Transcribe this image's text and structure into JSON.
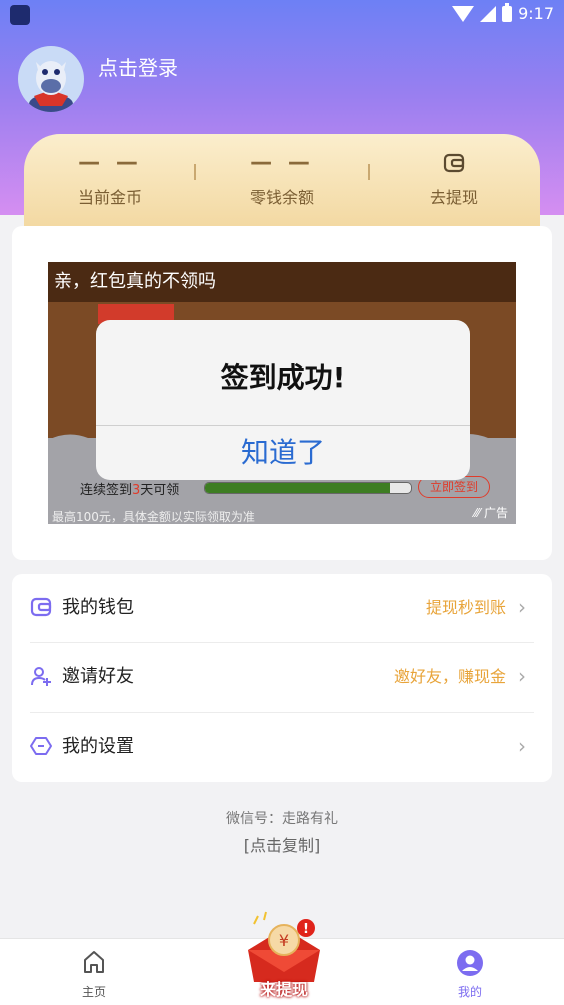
{
  "status_bar": {
    "time": "9:17",
    "battery": "8"
  },
  "profile": {
    "login_text": "点击登录"
  },
  "coin_panel": {
    "items": [
      {
        "value": "— —",
        "label": "当前金币"
      },
      {
        "value": "— —",
        "label": "零钱余额"
      },
      {
        "value": "",
        "label": "去提现"
      }
    ]
  },
  "ad": {
    "title": "亲，红包真的不领吗",
    "sign_prefix": "连续签到",
    "sign_days": "3",
    "sign_suffix": "天可领",
    "progress": 0.9,
    "sign_button": "立即签到",
    "footer_note": "最高100元，具体金额以实际领取为准",
    "ad_tag": "广告"
  },
  "dialog": {
    "title": "签到成功!",
    "confirm": "知道了"
  },
  "menu": [
    {
      "label": "我的钱包",
      "right": "提现秒到账",
      "icon": "wallet-icon"
    },
    {
      "label": "邀请好友",
      "right": "邀好友，赚现金",
      "icon": "add-user-icon"
    },
    {
      "label": "我的设置",
      "right": "",
      "icon": "settings-icon"
    }
  ],
  "contact": {
    "wechat": "微信号：走路有礼",
    "copy": "[点击复制]"
  },
  "tabbar": {
    "home": "主页",
    "center": "来提现",
    "mine": "我的"
  },
  "colors": {
    "accent": "#7c6cf0",
    "orange": "#e8a43a",
    "dialog_button": "#2a6bd1"
  }
}
